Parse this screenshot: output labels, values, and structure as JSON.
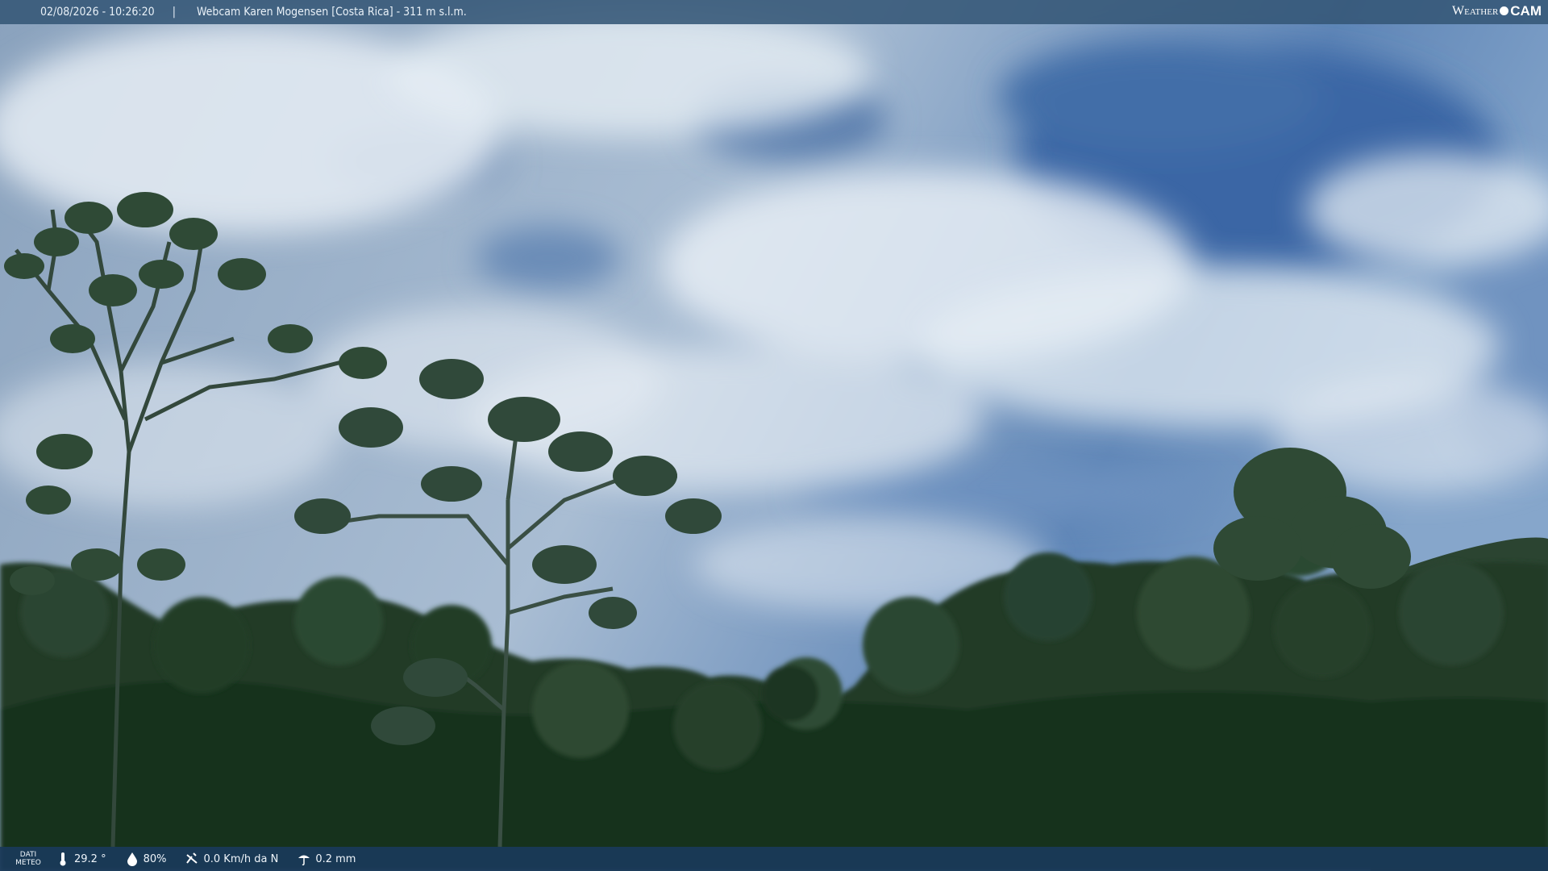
{
  "header": {
    "datetime": "02/08/2026 - 10:26:20",
    "separator": "|",
    "title": "Webcam Karen Mogensen [Costa Rica] - 311 m s.l.m."
  },
  "logo": {
    "word": "Weather",
    "cam": "CAM"
  },
  "weather_bar": {
    "label_line1": "DATI",
    "label_line2": "METEO",
    "temperature": "29.2 °",
    "humidity": "80%",
    "wind": "0.0 Km/h da N",
    "rain": "0.2 mm"
  },
  "icons": {
    "temperature": "thermometer-icon",
    "humidity": "droplet-icon",
    "wind": "wind-icon",
    "rain": "rain-icon"
  },
  "colors": {
    "bar_top": "#345676",
    "bar_bottom": "#1a3a5a",
    "sky": "#3f6fa8",
    "forest": "#1c3222"
  }
}
